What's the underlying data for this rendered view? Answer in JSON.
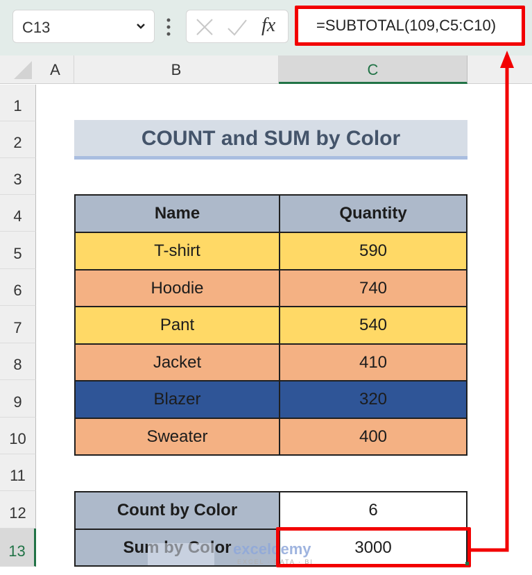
{
  "formula_bar": {
    "name_box": "C13",
    "formula": "=SUBTOTAL(109,C5:C10)",
    "icons": [
      "cancel-icon",
      "enter-icon",
      "fx-icon"
    ],
    "fx_label": "fx"
  },
  "columns": [
    "A",
    "B",
    "C"
  ],
  "rows": [
    "1",
    "2",
    "3",
    "4",
    "5",
    "6",
    "7",
    "8",
    "9",
    "10",
    "11",
    "12",
    "13"
  ],
  "selected_cell": "C13",
  "title": "COUNT and SUM by Color",
  "table": {
    "headers": [
      "Name",
      "Quantity"
    ],
    "rows": [
      {
        "name": "T-shirt",
        "quantity": "590",
        "fill": "#ffd966"
      },
      {
        "name": "Hoodie",
        "quantity": "740",
        "fill": "#f4b183"
      },
      {
        "name": "Pant",
        "quantity": "540",
        "fill": "#ffd966"
      },
      {
        "name": "Jacket",
        "quantity": "410",
        "fill": "#f4b183"
      },
      {
        "name": "Blazer",
        "quantity": "320",
        "fill": "#2f5597"
      },
      {
        "name": "Sweater",
        "quantity": "400",
        "fill": "#f4b183"
      }
    ]
  },
  "summary": {
    "count_label": "Count by Color",
    "count_value": "6",
    "sum_label": "Sum by Color",
    "sum_value": "3000"
  },
  "watermark": {
    "name": "exceldemy",
    "tagline": "EXCEL · DATA · BI"
  },
  "annotation_color": "#f20000"
}
